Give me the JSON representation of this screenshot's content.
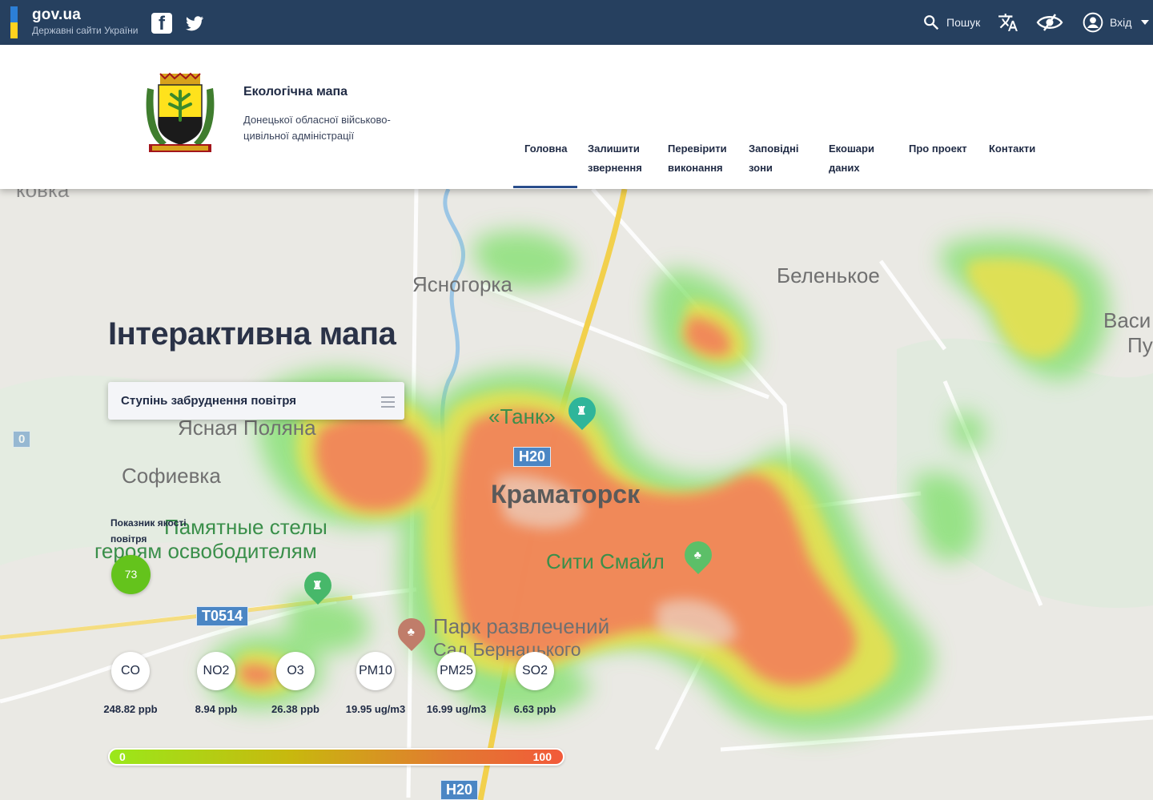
{
  "govbar": {
    "title": "gov.ua",
    "subtitle": "Державні сайти України",
    "search_label": "Пошук",
    "login_label": "Вхід",
    "icons": [
      "facebook-icon",
      "twitter-icon",
      "search-icon",
      "translate-icon",
      "accessibility-eye-icon",
      "user-icon",
      "caret-down-icon"
    ]
  },
  "header": {
    "title": "Екологічна мапа",
    "subtitle": "Донецької обласної військово-цивільної адміністрації",
    "nav": [
      {
        "label": "Головна",
        "active": true
      },
      {
        "label": "Залишити звернення"
      },
      {
        "label": "Перевірити виконання"
      },
      {
        "label": "Заповідні зони"
      },
      {
        "label": "Екошари даних"
      },
      {
        "label": "Про проект"
      },
      {
        "label": "Контакти"
      }
    ]
  },
  "map": {
    "labels": {
      "yasnogorka": "Ясногорка",
      "belenkoe": "Беленькое",
      "vasi": "Васи",
      "pu": "Пу",
      "tank": "«Танк»",
      "yasnaya": "Ясная Поляна",
      "sofievka": "Софиевка",
      "kramatorsk": "Краматорск",
      "stely1": "Памятные стелы",
      "stely2": "героям освободителям",
      "city_smile": "Сити Смайл",
      "park1": "Парк развлечений",
      "park2": "Сад Бернацького",
      "top_fragment": "ковка",
      "left_fragment": "0"
    },
    "roads": {
      "h20_top": "H20",
      "t0514": "T0514",
      "h20_bottom": "H20"
    },
    "colors": {
      "heat_high": "#f47a5a",
      "heat_mid": "#f0e04a",
      "heat_low": "#7fe06a",
      "road_main": "#f2d04c",
      "water": "#7ab6e6"
    }
  },
  "panel": {
    "heading": "Інтерактивна мапа",
    "dropdown_label": "Ступінь забруднення повітря",
    "aqi_label": "Показник якості повітря",
    "aqi_value": "73",
    "aqi_color": "#64c31c",
    "pollutants": [
      {
        "name": "CO",
        "value": "248.82 ppb"
      },
      {
        "name": "NO2",
        "value": "8.94 ppb"
      },
      {
        "name": "O3",
        "value": "26.38 ppb"
      },
      {
        "name": "PM10",
        "value": "19.95 ug/m3"
      },
      {
        "name": "PM25",
        "value": "16.99 ug/m3"
      },
      {
        "name": "SO2",
        "value": "6.63 ppb"
      }
    ],
    "scale_min": "0",
    "scale_max": "100"
  }
}
